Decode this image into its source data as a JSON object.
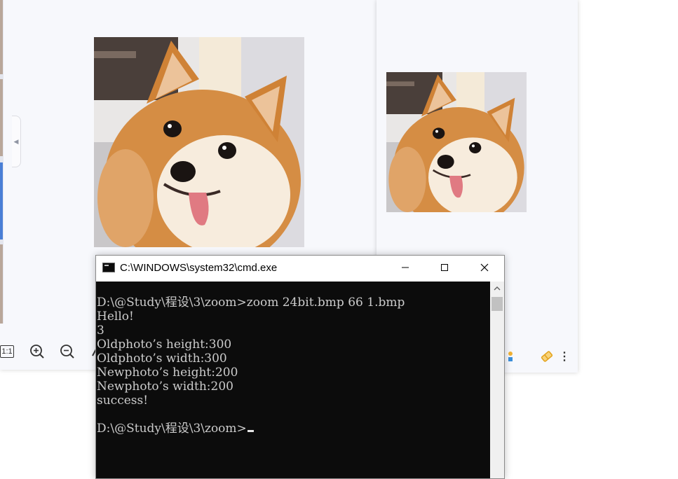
{
  "viewer_left": {
    "toolbar": {
      "actual_size_label": "1:1",
      "zoom_in_icon": "zoom-in-icon",
      "zoom_out_icon": "zoom-out-icon",
      "edit_icon": "pen-icon"
    },
    "collapse_icon": "chevron-left-icon"
  },
  "viewer_right": {
    "toolbar": {
      "apps_icon": "apps-icon",
      "eraser_icon": "eraser-icon",
      "more_label": "⋮"
    }
  },
  "cmd": {
    "title": "C:\\WINDOWS\\system32\\cmd.exe",
    "lines": [
      "D:\\@Study\\程设\\3\\zoom>zoom 24bit.bmp 66 1.bmp",
      "Hello!",
      "3",
      "Oldphoto’s height:300",
      "Oldphoto’s width:300",
      "Newphoto’s height:200",
      "Newphoto’s width:200",
      "success!",
      "",
      "D:\\@Study\\程设\\3\\zoom>"
    ]
  },
  "colors": {
    "console_bg": "#0c0c0c",
    "console_text": "#cccccc",
    "viewer_bg": "#f7f8fc",
    "accent": "#4a7fd6"
  }
}
